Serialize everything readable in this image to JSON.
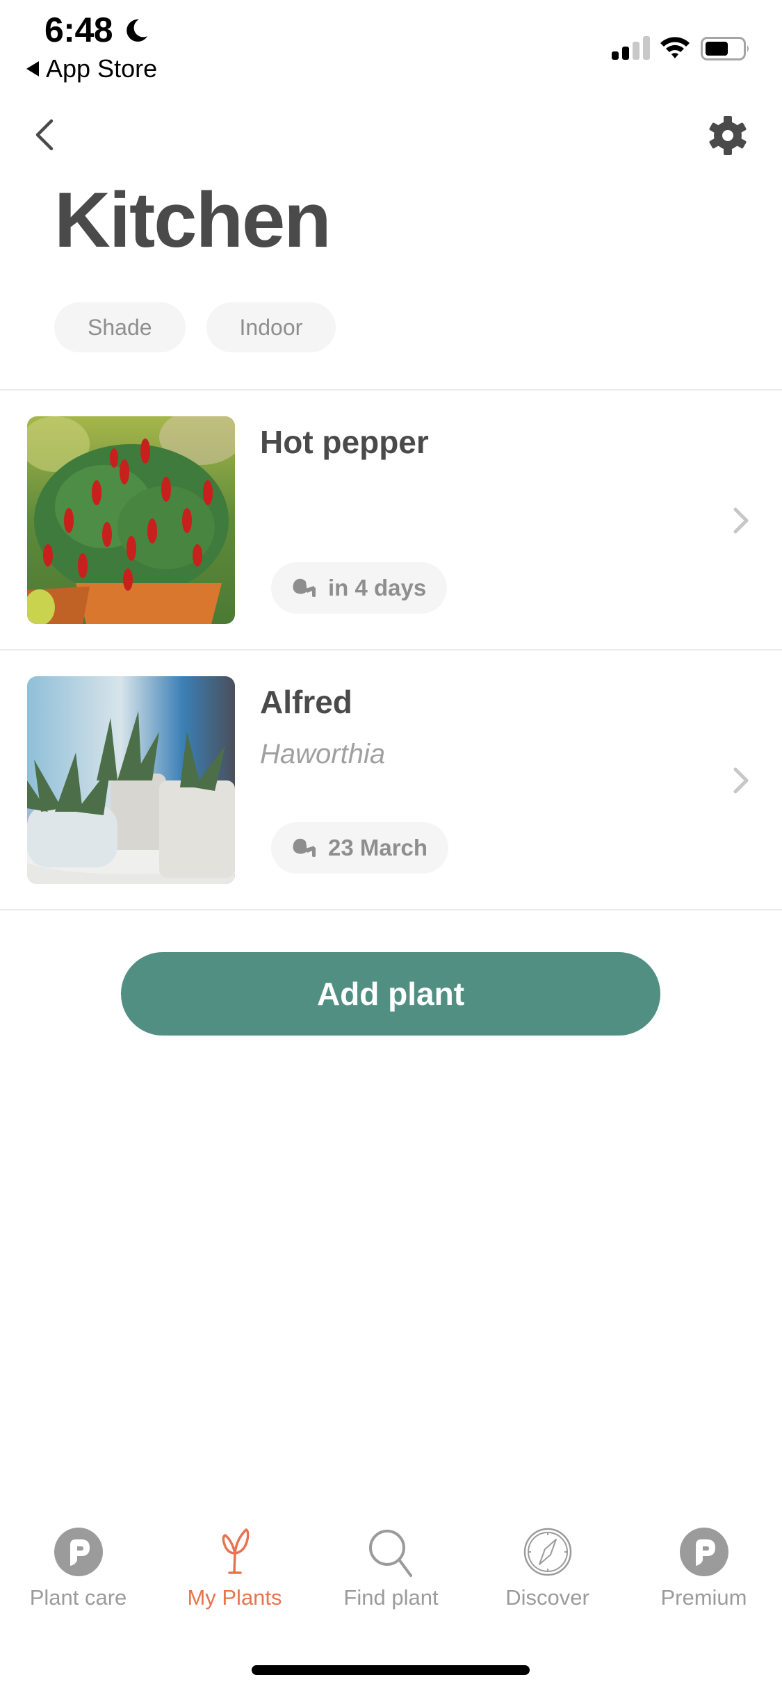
{
  "status_bar": {
    "time": "6:48",
    "back_app_label": "App Store",
    "signal_bars_filled": 2,
    "signal_bars_total": 4,
    "battery_level": 0.6,
    "icons": [
      "moon-icon",
      "signal-icon",
      "wifi-icon",
      "battery-icon"
    ]
  },
  "header": {
    "back_icon": "chevron-left-icon",
    "settings_icon": "gear-icon",
    "title": "Kitchen",
    "tags": [
      {
        "label": "Shade"
      },
      {
        "label": "Indoor"
      }
    ]
  },
  "plants": [
    {
      "name": "Hot pepper",
      "species": "",
      "water_icon": "watering-can-icon",
      "water_label": "in 4 days",
      "photo": "hot pepper plant in terracotta pot"
    },
    {
      "name": "Alfred",
      "species": "Haworthia",
      "water_icon": "watering-can-icon",
      "water_label": "23 March",
      "photo": "haworthia succulents in white pots"
    }
  ],
  "actions": {
    "add_plant_label": "Add plant"
  },
  "tabbar": {
    "active_index": 1,
    "items": [
      {
        "label": "Plant care",
        "icon": "planta-logo-icon"
      },
      {
        "label": "My Plants",
        "icon": "sprout-icon"
      },
      {
        "label": "Find plant",
        "icon": "search-icon"
      },
      {
        "label": "Discover",
        "icon": "compass-icon"
      },
      {
        "label": "Premium",
        "icon": "planta-logo-icon"
      }
    ]
  },
  "colors": {
    "accent_green": "#518f82",
    "active_tab": "#e9734f",
    "text_dark": "#4a4a4a",
    "text_muted": "#8e8e8e",
    "pill_bg": "#f5f5f5"
  }
}
